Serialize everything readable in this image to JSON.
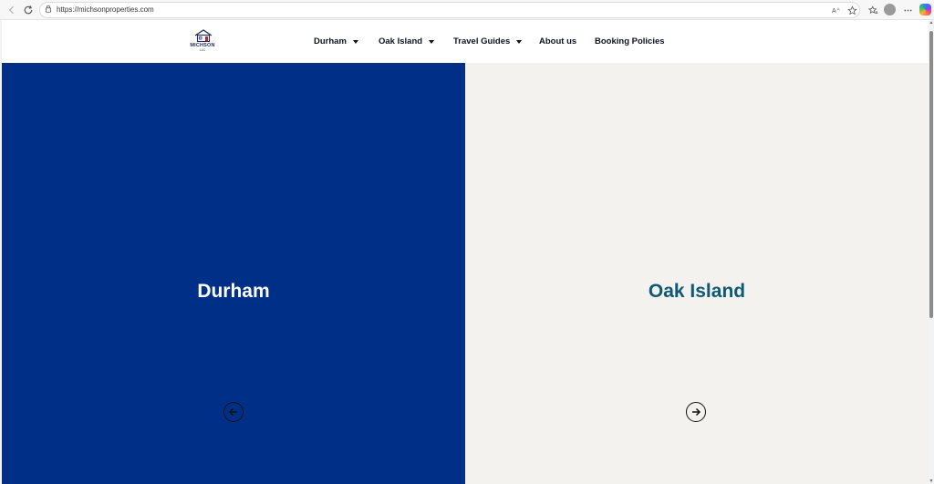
{
  "browser": {
    "url": "https://michsonproperties.com",
    "icons": {
      "back": "arrow-left",
      "refresh": "refresh",
      "lock": "lock",
      "read_aloud": "read-aloud",
      "favorite": "star",
      "favorites": "favorites",
      "more": "ellipsis"
    }
  },
  "site": {
    "logo": {
      "name": "MICHSON",
      "sub": "LLC"
    },
    "menu": [
      {
        "label": "Durham",
        "has_dropdown": true
      },
      {
        "label": "Oak Island",
        "has_dropdown": true
      },
      {
        "label": "Travel Guides",
        "has_dropdown": true
      },
      {
        "label": "About us",
        "has_dropdown": false
      },
      {
        "label": "Booking Policies",
        "has_dropdown": false
      }
    ]
  },
  "hero": {
    "left": {
      "title": "Durham",
      "background": "#002f87",
      "text_color": "#ffffff",
      "arrow": "arrow-left-circle"
    },
    "right": {
      "title": "Oak Island",
      "background": "#f3f2ef",
      "text_color": "#0e5a74",
      "arrow": "arrow-right-circle"
    }
  }
}
